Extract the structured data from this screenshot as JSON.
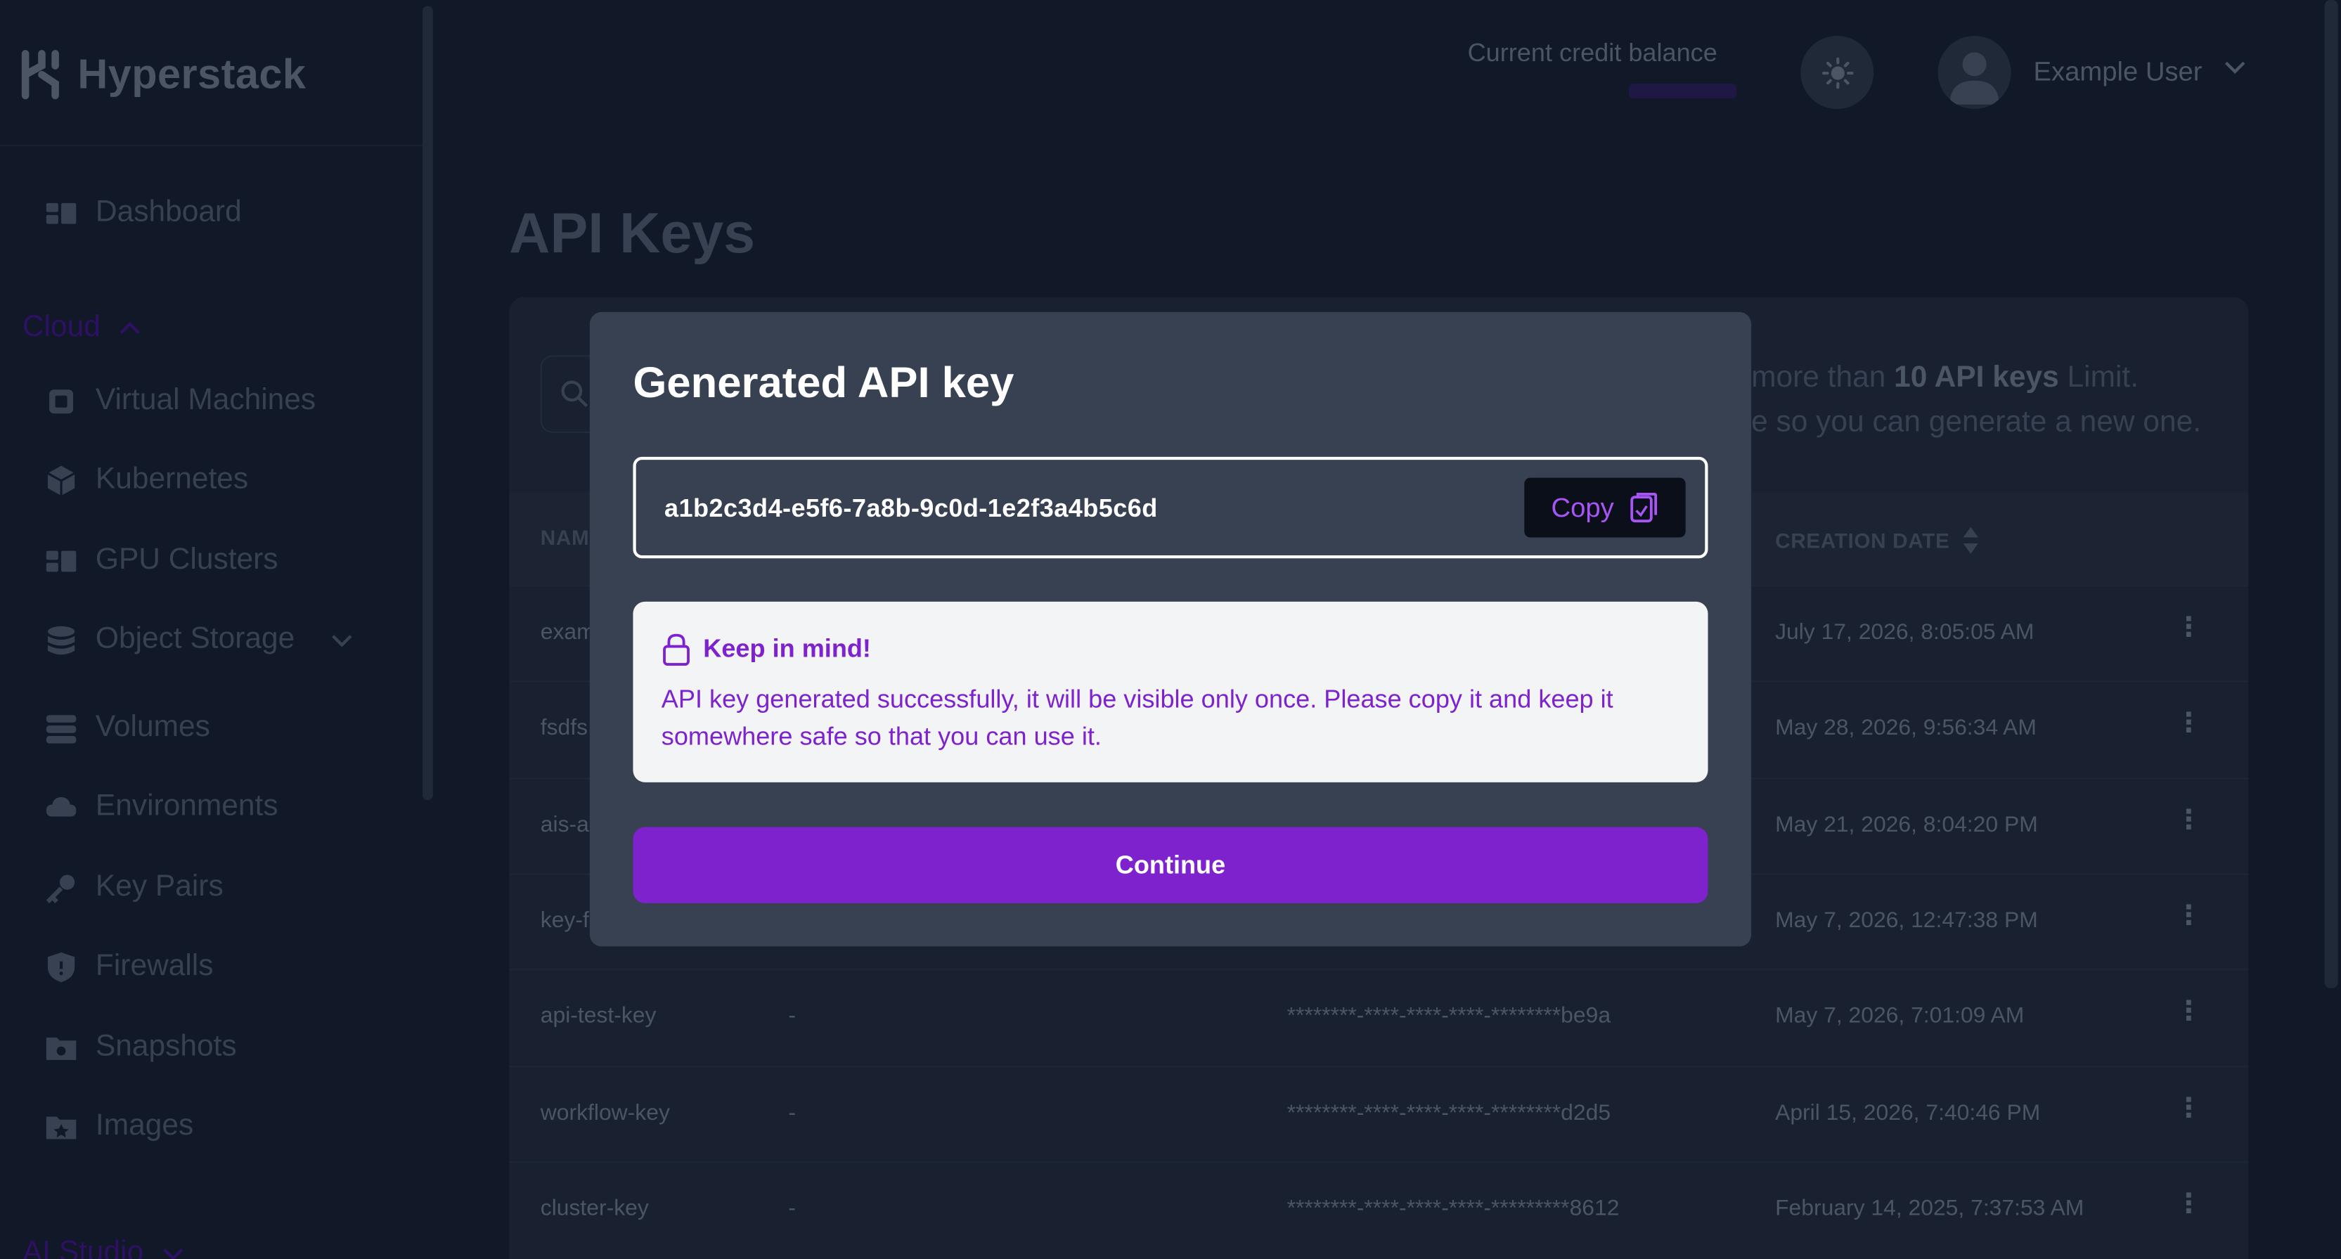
{
  "brand": {
    "name": "Hyperstack"
  },
  "sidebar": {
    "top_items": [
      {
        "label": "Dashboard",
        "icon": "dashboard-icon"
      }
    ],
    "cloud_section": {
      "label": "Cloud",
      "expanded": true
    },
    "items": [
      {
        "label": "Virtual Machines",
        "icon": "cpu-icon"
      },
      {
        "label": "Kubernetes",
        "icon": "cube-icon"
      },
      {
        "label": "GPU Clusters",
        "icon": "cluster-icon"
      },
      {
        "label": "Object Storage",
        "icon": "database-icon",
        "has_submenu": true
      },
      {
        "label": "Volumes",
        "icon": "server-icon"
      },
      {
        "label": "Environments",
        "icon": "cloud-icon"
      },
      {
        "label": "Key Pairs",
        "icon": "key-icon"
      },
      {
        "label": "Firewalls",
        "icon": "shield-icon"
      },
      {
        "label": "Snapshots",
        "icon": "camera-folder-icon"
      },
      {
        "label": "Images",
        "icon": "image-folder-icon"
      }
    ],
    "ai_section": {
      "label": "AI Studio"
    }
  },
  "header": {
    "credit_label": "Current credit balance",
    "user_name": "Example User"
  },
  "page": {
    "title": "API Keys",
    "limit_note_prefix": "more than ",
    "limit_note_bold": "10 API keys",
    "limit_note_suffix": " Limit.",
    "limit_note_line2": "e so you can generate a new one.",
    "columns": {
      "name": "NAM",
      "created": "CREATION DATE"
    },
    "rows": [
      {
        "name": "exam",
        "description": "",
        "key": "",
        "created": "July 17, 2026, 8:05:05 AM"
      },
      {
        "name": "fsdfs",
        "description": "",
        "key": "",
        "created": "May 28, 2026, 9:56:34 AM"
      },
      {
        "name": "ais-a",
        "description": "",
        "key": "",
        "created": "May 21, 2026, 8:04:20 PM"
      },
      {
        "name": "key-f",
        "description": "",
        "key": "",
        "created": "May 7, 2026, 12:47:38 PM"
      },
      {
        "name": "api-test-key",
        "description": "-",
        "key": "********-****-****-****-********be9a",
        "created": "May 7, 2026, 7:01:09 AM"
      },
      {
        "name": "workflow-key",
        "description": "-",
        "key": "********-****-****-****-********d2d5",
        "created": "April 15, 2026, 7:40:46 PM"
      },
      {
        "name": "cluster-key",
        "description": "-",
        "key": "********-****-****-****-*********8612",
        "created": "February 14, 2025, 7:37:53 AM"
      }
    ]
  },
  "modal": {
    "title": "Generated API key",
    "api_key": "a1b2c3d4-e5f6-7a8b-9c0d-1e2f3a4b5c6d",
    "copy_label": "Copy",
    "notice_title": "Keep in mind!",
    "notice_body": "API key generated successfully, it will be visible only once. Please copy it and keep it somewhere safe so that you can use it.",
    "continue_label": "Continue"
  },
  "colors": {
    "background": "#111827",
    "modal": "#374151",
    "accent": "#7e22ce",
    "notice_bg": "#f3f4f6"
  }
}
